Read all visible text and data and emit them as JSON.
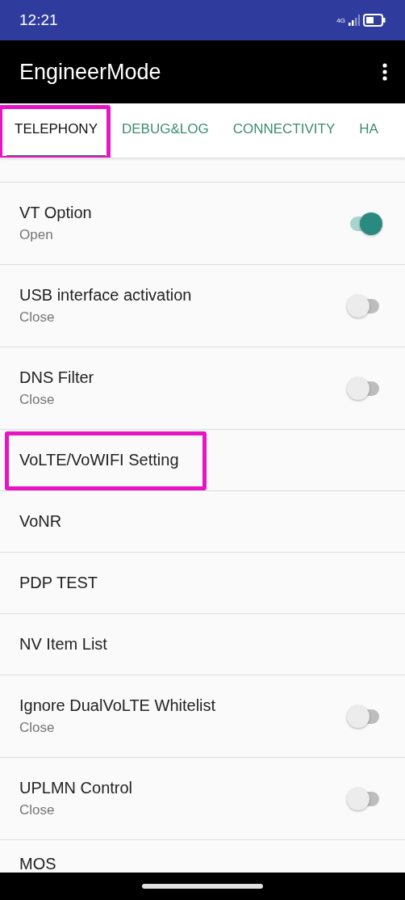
{
  "status_bar": {
    "time": "12:21",
    "network": "4G"
  },
  "app_bar": {
    "title": "EngineerMode"
  },
  "tabs": [
    {
      "label": "TELEPHONY",
      "selected": true,
      "highlighted": true
    },
    {
      "label": "DEBUG&LOG",
      "selected": false,
      "highlighted": false
    },
    {
      "label": "CONNECTIVITY",
      "selected": false,
      "highlighted": false
    },
    {
      "label": "HA",
      "selected": false,
      "highlighted": false
    }
  ],
  "items": [
    {
      "kind": "toggle",
      "title": "VT Option",
      "summary": "Open",
      "on": true,
      "highlighted": false
    },
    {
      "kind": "toggle",
      "title": "USB interface activation",
      "summary": "Close",
      "on": false,
      "highlighted": false
    },
    {
      "kind": "toggle",
      "title": "DNS Filter",
      "summary": "Close",
      "on": false,
      "highlighted": false
    },
    {
      "kind": "link",
      "title": "VoLTE/VoWIFI Setting",
      "highlighted": true
    },
    {
      "kind": "link",
      "title": "VoNR",
      "highlighted": false
    },
    {
      "kind": "link",
      "title": "PDP TEST",
      "highlighted": false
    },
    {
      "kind": "link",
      "title": "NV Item List",
      "highlighted": false
    },
    {
      "kind": "toggle",
      "title": "Ignore DualVoLTE Whitelist",
      "summary": "Close",
      "on": false,
      "highlighted": false
    },
    {
      "kind": "toggle",
      "title": "UPLMN Control",
      "summary": "Close",
      "on": false,
      "highlighted": false
    },
    {
      "kind": "link",
      "title": "MOS",
      "highlighted": false
    }
  ]
}
